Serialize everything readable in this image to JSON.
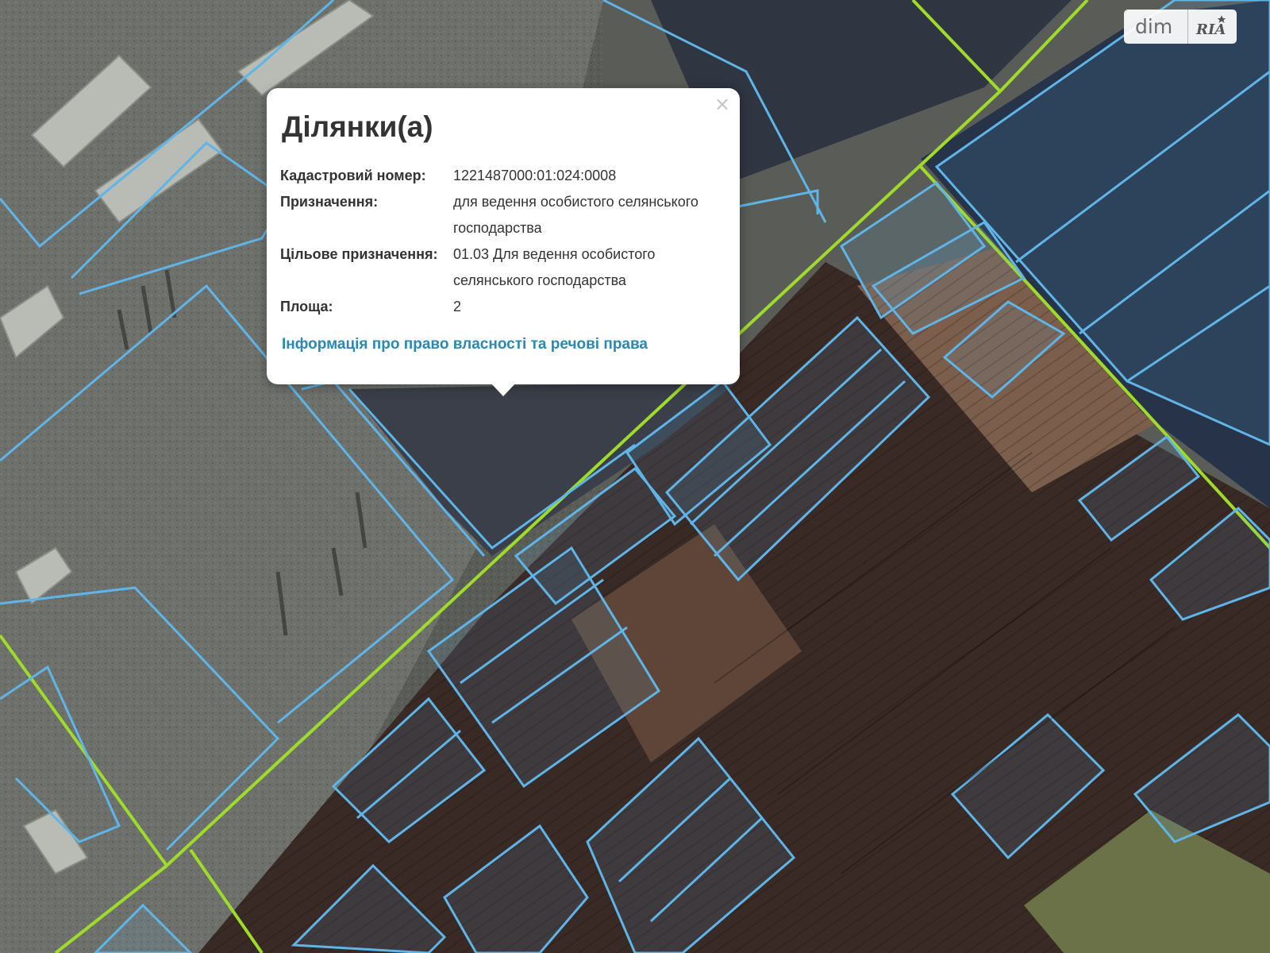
{
  "popup": {
    "title": "Ділянки(а)",
    "close_symbol": "×",
    "rows": [
      {
        "key": "Кадастровий номер:",
        "value": "1221487000:01:024:0008"
      },
      {
        "key": "Призначення:",
        "value": "для ведення особистого селянського господарства"
      },
      {
        "key": "Цільове призначення:",
        "value": "01.03 Для ведення особистого селянського господарства"
      },
      {
        "key": "Площа:",
        "value": "2"
      }
    ],
    "link": "Інформація про право власності та речові права"
  },
  "logo": {
    "left": "dim",
    "right": "RIA"
  },
  "colors": {
    "parcel_outline": "#5fb4e8",
    "boundary_line": "#9fdb2b",
    "link": "#2a88b4"
  }
}
